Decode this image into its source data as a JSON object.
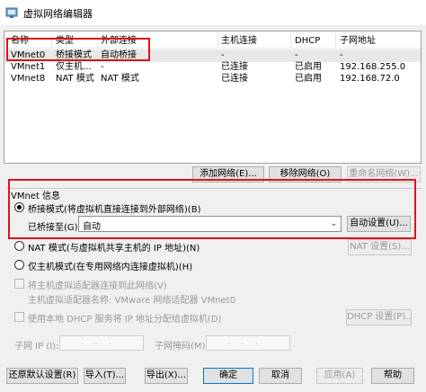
{
  "window": {
    "title": "虚拟网络编辑器"
  },
  "colors": {
    "highlight_red": "#d9151b",
    "selected_row": "#e8e8e8",
    "focus_blue": "#0078d7"
  },
  "table": {
    "headers": [
      "名称",
      "类型",
      "外部连接",
      "主机连接",
      "DHCP",
      "子网地址"
    ],
    "rows": [
      {
        "name": "VMnet0",
        "type": "桥接模式",
        "external": "自动桥接",
        "host": "-",
        "dhcp": "-",
        "subnet": "-"
      },
      {
        "name": "VMnet1",
        "type": "仅主机...",
        "external": "-",
        "host": "已连接",
        "dhcp": "已启用",
        "subnet": "192.168.255.0"
      },
      {
        "name": "VMnet8",
        "type": "NAT 模式",
        "external": "NAT 模式",
        "host": "已连接",
        "dhcp": "已启用",
        "subnet": "192.168.72.0"
      }
    ]
  },
  "table_buttons": {
    "add": "添加网络(E)...",
    "remove": "移除网络(O)",
    "rename": "重命名网络(W)..."
  },
  "info": {
    "group_title": "VMnet 信息",
    "bridged_label": "桥接模式(将虚拟机直接连接到外部网络)(B)",
    "bridged_to_label": "已桥接至(G):",
    "bridged_to_value": "自动",
    "auto_settings": "自动设置(U)...",
    "nat_label": "NAT 模式(与虚拟机共享主机的 IP 地址)(N)",
    "nat_settings": "NAT 设置(S)...",
    "hostonly_label": "仅主机模式(在专用网络内连接虚拟机)(H)",
    "connect_adapter_label": "将主机虚拟适配器连接到此网络(V)",
    "adapter_name_label": "主机虚拟适配器名称: VMware 网络适配器 VMnet0",
    "dhcp_label": "使用本地 DHCP 服务将 IP 地址分配给虚拟机(D)",
    "dhcp_settings": "DHCP 设置(P)...",
    "subnet_ip_label": "子网 IP (I):",
    "subnet_mask_label": "子网掩码(M):",
    "ip_dots": "...",
    "mask_dots": "..."
  },
  "footer": {
    "restore": "还原默认设置(R)",
    "import": "导入(T)...",
    "export": "导出(X)...",
    "ok": "确定",
    "cancel": "取消",
    "apply": "应用(A)",
    "help": "帮助"
  }
}
